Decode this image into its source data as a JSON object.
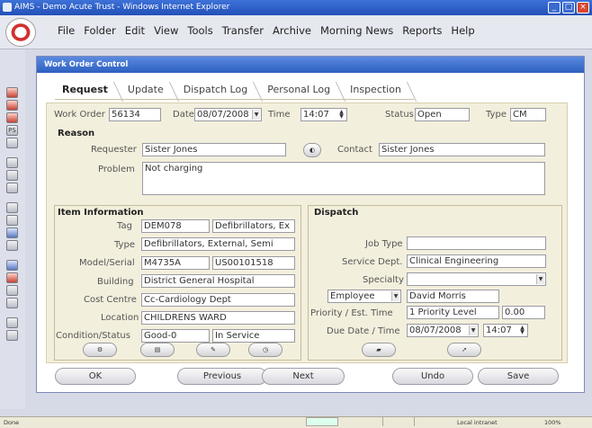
{
  "browser": {
    "title": "AIMS - Demo Acute Trust - Windows Internet Explorer",
    "controls": [
      "_",
      "□",
      "×"
    ]
  },
  "menu": [
    "File",
    "Folder",
    "Edit",
    "View",
    "Tools",
    "Transfer",
    "Archive",
    "Morning News",
    "Reports",
    "Help"
  ],
  "toolbar_icons": [
    "record-icon",
    "record-icon",
    "record-icon",
    "PS",
    "record-icon",
    "search-icon",
    "binoculars-icon",
    "grid-icon",
    "list-icon",
    "report-icon",
    "location-icon",
    "filter-icon",
    "record-icon",
    "record-icon",
    "calendar-icon",
    "calendar-icon",
    "notes-icon",
    "print-icon"
  ],
  "window": {
    "title": "Work Order Control",
    "tabs": [
      "Request",
      "Update",
      "Dispatch Log",
      "Personal Log",
      "Inspection"
    ],
    "active_tab": "Request"
  },
  "header": {
    "work_order_label": "Work Order",
    "work_order": "56134",
    "date_label": "Date",
    "date": "08/07/2008",
    "time_label": "Time",
    "time": "14:07",
    "status_label": "Status",
    "status": "Open",
    "type_label": "Type",
    "type": "CM"
  },
  "reason": {
    "title": "Reason",
    "requester_label": "Requester",
    "requester": "Sister Jones",
    "contact_label": "Contact",
    "contact": "Sister Jones",
    "problem_label": "Problem",
    "problem": "Not charging"
  },
  "item": {
    "title": "Item Information",
    "tag_label": "Tag",
    "tag": "DEM078",
    "tag_desc": "Defibrillators, Ex",
    "type_label": "Type",
    "type": "Defibrillators, External, Semi",
    "model_label": "Model/Serial",
    "model": "M4735A",
    "serial": "US00101518",
    "building_label": "Building",
    "building": "District General Hospital",
    "cost_centre_label": "Cost Centre",
    "cost_centre": "Cc-Cardiology Dept",
    "location_label": "Location",
    "location": "CHILDRENS WARD",
    "condition_label": "Condition/Status",
    "condition": "Good-0",
    "status": "In Service"
  },
  "dispatch": {
    "title": "Dispatch",
    "job_type_label": "Job Type",
    "job_type": "",
    "service_dept_label": "Service Dept.",
    "service_dept": "Clinical Engineering",
    "specialty_label": "Specialty",
    "specialty": "",
    "assign_type": "Employee",
    "assignee": "David Morris",
    "priority_label": "Priority / Est. Time",
    "priority": "1 Priority Level",
    "est_time": "0.00",
    "due_label": "Due Date / Time",
    "due_date": "08/07/2008",
    "due_time": "14:07"
  },
  "buttons": {
    "ok": "OK",
    "previous": "Previous",
    "next": "Next",
    "undo": "Undo",
    "save": "Save"
  },
  "statusbar": {
    "left": "Done",
    "zone": "Local intranet",
    "zoom": "100%"
  }
}
